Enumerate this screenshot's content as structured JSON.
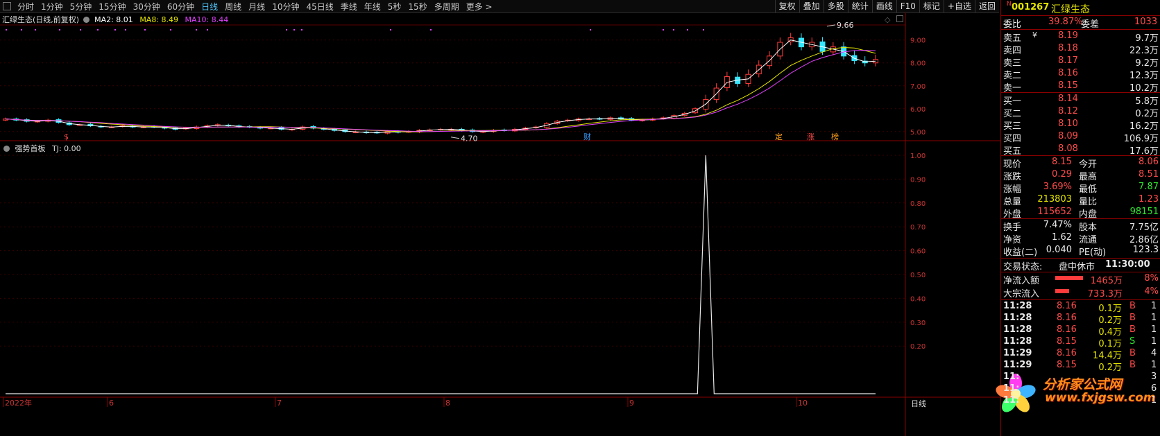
{
  "toolbar": {
    "periods": [
      "分时",
      "1分钟",
      "5分钟",
      "15分钟",
      "30分钟",
      "60分钟",
      "日线",
      "周线",
      "月线",
      "10分钟",
      "45日线",
      "季线",
      "年线",
      "5秒",
      "15秒",
      "多周期",
      "更多 >"
    ],
    "active_period": "日线",
    "tools": [
      "复权",
      "叠加",
      "多股",
      "统计",
      "画线",
      "F10",
      "标记",
      "+自选",
      "返回"
    ]
  },
  "kline_header": {
    "title": "汇绿生态(日线,前复权)",
    "ma2": "MA2: 8.01",
    "ma8": "MA8: 8.49",
    "ma10": "MA10: 8.44"
  },
  "indicator_header": {
    "name": "强势首板",
    "value": "TJ: 0.00"
  },
  "price_axis": [
    "9.00",
    "8.00",
    "7.00",
    "6.00",
    "5.00"
  ],
  "indicator_axis": [
    "1.00",
    "0.90",
    "0.80",
    "0.70",
    "0.60",
    "0.50",
    "0.40",
    "0.30",
    "0.20"
  ],
  "x_axis": [
    "2022年",
    "6",
    "7",
    "8",
    "9",
    "10"
  ],
  "x_axis_corner": "日线",
  "annotations": {
    "high": "9.66",
    "low": "4.70",
    "markers": [
      "$",
      "财",
      "定",
      "涨",
      "榜"
    ]
  },
  "colors": {
    "up": "#ff3b3b",
    "down": "#36e6ff",
    "ma2": "#ffffff",
    "ma8": "#e6e600",
    "ma10": "#e040fb",
    "panel_border": "#8b0000"
  },
  "chart_data": [
    {
      "type": "candlestick",
      "title": "汇绿生态(日线,前复权)",
      "ylim": [
        4.6,
        9.9
      ],
      "closes": [
        5.55,
        5.5,
        5.45,
        5.45,
        5.5,
        5.4,
        5.3,
        5.3,
        5.25,
        5.2,
        5.2,
        5.25,
        5.2,
        5.2,
        5.2,
        5.15,
        5.1,
        5.15,
        5.2,
        5.25,
        5.3,
        5.25,
        5.2,
        5.2,
        5.15,
        5.15,
        5.1,
        5.1,
        5.2,
        5.15,
        5.1,
        5.05,
        5.0,
        4.98,
        4.95,
        4.95,
        5.0,
        4.97,
        5.0,
        5.05,
        5.07,
        5.1,
        5.1,
        5.05,
        5.0,
        5.0,
        5.05,
        5.05,
        5.1,
        5.15,
        5.2,
        5.35,
        5.45,
        5.5,
        5.55,
        5.55,
        5.55,
        5.6,
        5.55,
        5.5,
        5.5,
        5.55,
        5.6,
        5.7,
        5.8,
        6.0,
        6.4,
        6.9,
        7.4,
        7.1,
        7.5,
        7.9,
        8.3,
        8.9,
        9.1,
        8.7,
        8.9,
        8.5,
        8.7,
        8.3,
        8.1,
        8.0,
        8.15
      ],
      "series": [
        {
          "name": "MA2",
          "value": 8.01
        },
        {
          "name": "MA8",
          "value": 8.49
        },
        {
          "name": "MA10",
          "value": 8.44
        }
      ]
    },
    {
      "type": "line",
      "title": "强势首板",
      "ylim": [
        0,
        1.0
      ],
      "values_note": "TJ",
      "values": [
        0,
        0,
        0,
        0,
        0,
        0,
        0,
        0,
        0,
        0,
        0,
        0,
        0,
        0,
        0,
        0,
        0,
        0,
        0,
        0,
        0,
        0,
        0,
        0,
        0,
        0,
        0,
        0,
        0,
        0,
        0,
        0,
        0,
        0,
        0,
        0,
        0,
        0,
        0,
        0,
        0,
        0,
        0,
        0,
        0,
        0,
        0,
        0,
        0,
        0,
        0,
        0,
        0,
        0,
        0,
        0,
        0,
        0,
        0,
        0,
        0,
        0,
        0,
        0,
        0,
        0,
        1,
        0,
        0,
        0,
        0,
        0,
        0,
        0,
        0,
        0,
        0,
        0,
        0,
        0,
        0,
        0,
        0
      ]
    }
  ],
  "quote": {
    "code": "001267",
    "name": "汇绿生态",
    "weibi_label": "委比",
    "weibi": "39.87%",
    "weicha_label": "委差",
    "weicha": "1033",
    "asks": [
      {
        "label": "卖五",
        "mark": "¥",
        "price": "8.19",
        "vol": "9.7万"
      },
      {
        "label": "卖四",
        "price": "8.18",
        "vol": "22.3万"
      },
      {
        "label": "卖三",
        "price": "8.17",
        "vol": "9.2万"
      },
      {
        "label": "卖二",
        "price": "8.16",
        "vol": "12.3万"
      },
      {
        "label": "卖一",
        "price": "8.15",
        "vol": "10.2万"
      }
    ],
    "bids": [
      {
        "label": "买一",
        "price": "8.14",
        "vol": "5.8万"
      },
      {
        "label": "买二",
        "price": "8.12",
        "vol": "0.2万"
      },
      {
        "label": "买三",
        "price": "8.10",
        "vol": "16.2万"
      },
      {
        "label": "买四",
        "price": "8.09",
        "vol": "106.9万"
      },
      {
        "label": "买五",
        "price": "8.08",
        "vol": "17.6万"
      }
    ],
    "stats": [
      {
        "l1": "现价",
        "v1": "8.15",
        "l2": "今开",
        "v2": "8.06"
      },
      {
        "l1": "涨跌",
        "v1": "0.29",
        "l2": "最高",
        "v2": "8.51"
      },
      {
        "l1": "涨幅",
        "v1": "3.69%",
        "l2": "最低",
        "v2": "7.87"
      },
      {
        "l1": "总量",
        "v1": "213803",
        "l2": "量比",
        "v2": "1.23"
      },
      {
        "l1": "外盘",
        "v1": "115652",
        "l2": "内盘",
        "v2": "98151"
      }
    ],
    "stats2": [
      {
        "l1": "换手",
        "v1": "7.47%",
        "l2": "股本",
        "v2": "7.75亿"
      },
      {
        "l1": "净资",
        "v1": "1.62",
        "l2": "流通",
        "v2": "2.86亿"
      },
      {
        "l1": "收益(二)",
        "v1": "0.040",
        "l2": "PE(动)",
        "v2": "123.3"
      }
    ],
    "status_label": "交易状态:",
    "status": "盘中休市",
    "status_time": "11:30:00",
    "flows": [
      {
        "label": "净流入额",
        "value": "1465万",
        "pct": "8%",
        "bar": 1.0
      },
      {
        "label": "大宗流入",
        "value": "733.3万",
        "pct": "4%",
        "bar": 0.5
      }
    ],
    "ticks": [
      {
        "time": "11:28",
        "price": "8.16",
        "vol": "0.1万",
        "side": "B",
        "n": "1"
      },
      {
        "time": "11:28",
        "price": "8.16",
        "vol": "0.2万",
        "side": "B",
        "n": "1"
      },
      {
        "time": "11:28",
        "price": "8.16",
        "vol": "0.4万",
        "side": "B",
        "n": "1"
      },
      {
        "time": "11:28",
        "price": "8.15",
        "vol": "0.1万",
        "side": "S",
        "n": "1"
      },
      {
        "time": "11:29",
        "price": "8.16",
        "vol": "14.4万",
        "side": "B",
        "n": "4"
      },
      {
        "time": "11:29",
        "price": "8.15",
        "vol": "0.2万",
        "side": "B",
        "n": "1"
      },
      {
        "time": "11:",
        "price": "",
        "vol": "",
        "side": "",
        "n": "3"
      },
      {
        "time": "11:",
        "price": "",
        "vol": "",
        "side": "",
        "n": "6"
      },
      {
        "time": "11:",
        "price": "",
        "vol": "",
        "side": "",
        "n": "1"
      }
    ],
    "watermark_title": "分析家公式网",
    "watermark_url": "www.fxjgsw.com"
  }
}
